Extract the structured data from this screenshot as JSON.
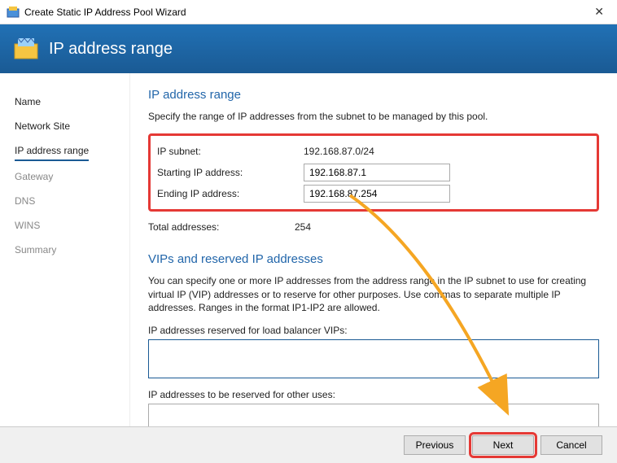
{
  "title": "Create Static IP Address Pool Wizard",
  "banner_title": "IP address range",
  "sidebar": {
    "items": [
      {
        "label": "Name",
        "state": "visited"
      },
      {
        "label": "Network Site",
        "state": "visited"
      },
      {
        "label": "IP address range",
        "state": "active"
      },
      {
        "label": "Gateway",
        "state": ""
      },
      {
        "label": "DNS",
        "state": ""
      },
      {
        "label": "WINS",
        "state": ""
      },
      {
        "label": "Summary",
        "state": ""
      }
    ]
  },
  "main": {
    "heading1": "IP address range",
    "desc1": "Specify the range of IP addresses from the subnet to be managed by this pool.",
    "subnet_label": "IP subnet:",
    "subnet_value": "192.168.87.0/24",
    "start_label": "Starting IP address:",
    "start_value": "192.168.87.1",
    "end_label": "Ending IP address:",
    "end_value": "192.168.87.254",
    "total_label": "Total addresses:",
    "total_value": "254",
    "heading2": "VIPs and reserved IP addresses",
    "desc2": "You can specify one or more IP addresses from the address range in the IP subnet to use for creating virtual IP (VIP) addresses or to reserve for other purposes. Use commas to separate multiple IP addresses. Ranges in the format IP1-IP2 are allowed.",
    "vips_label": "IP addresses reserved for load balancer VIPs:",
    "vips_value": "",
    "other_label": "IP addresses to be reserved for other uses:",
    "other_value": ""
  },
  "footer": {
    "previous": "Previous",
    "next": "Next",
    "cancel": "Cancel"
  }
}
